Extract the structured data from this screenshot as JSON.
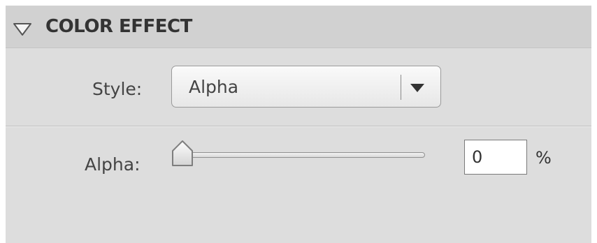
{
  "section": {
    "title": "COLOR EFFECT",
    "collapse_icon": "triangle-down-outline-icon"
  },
  "style": {
    "label": "Style:",
    "selected": "Alpha",
    "dropdown_icon": "triangle-down-filled-icon"
  },
  "alpha": {
    "label": "Alpha:",
    "value": "0",
    "unit": "%",
    "slider_value_percent": 0
  },
  "colors": {
    "panel_background": "#dddddd",
    "header_background": "#d1d1d1",
    "text": "#444444"
  }
}
